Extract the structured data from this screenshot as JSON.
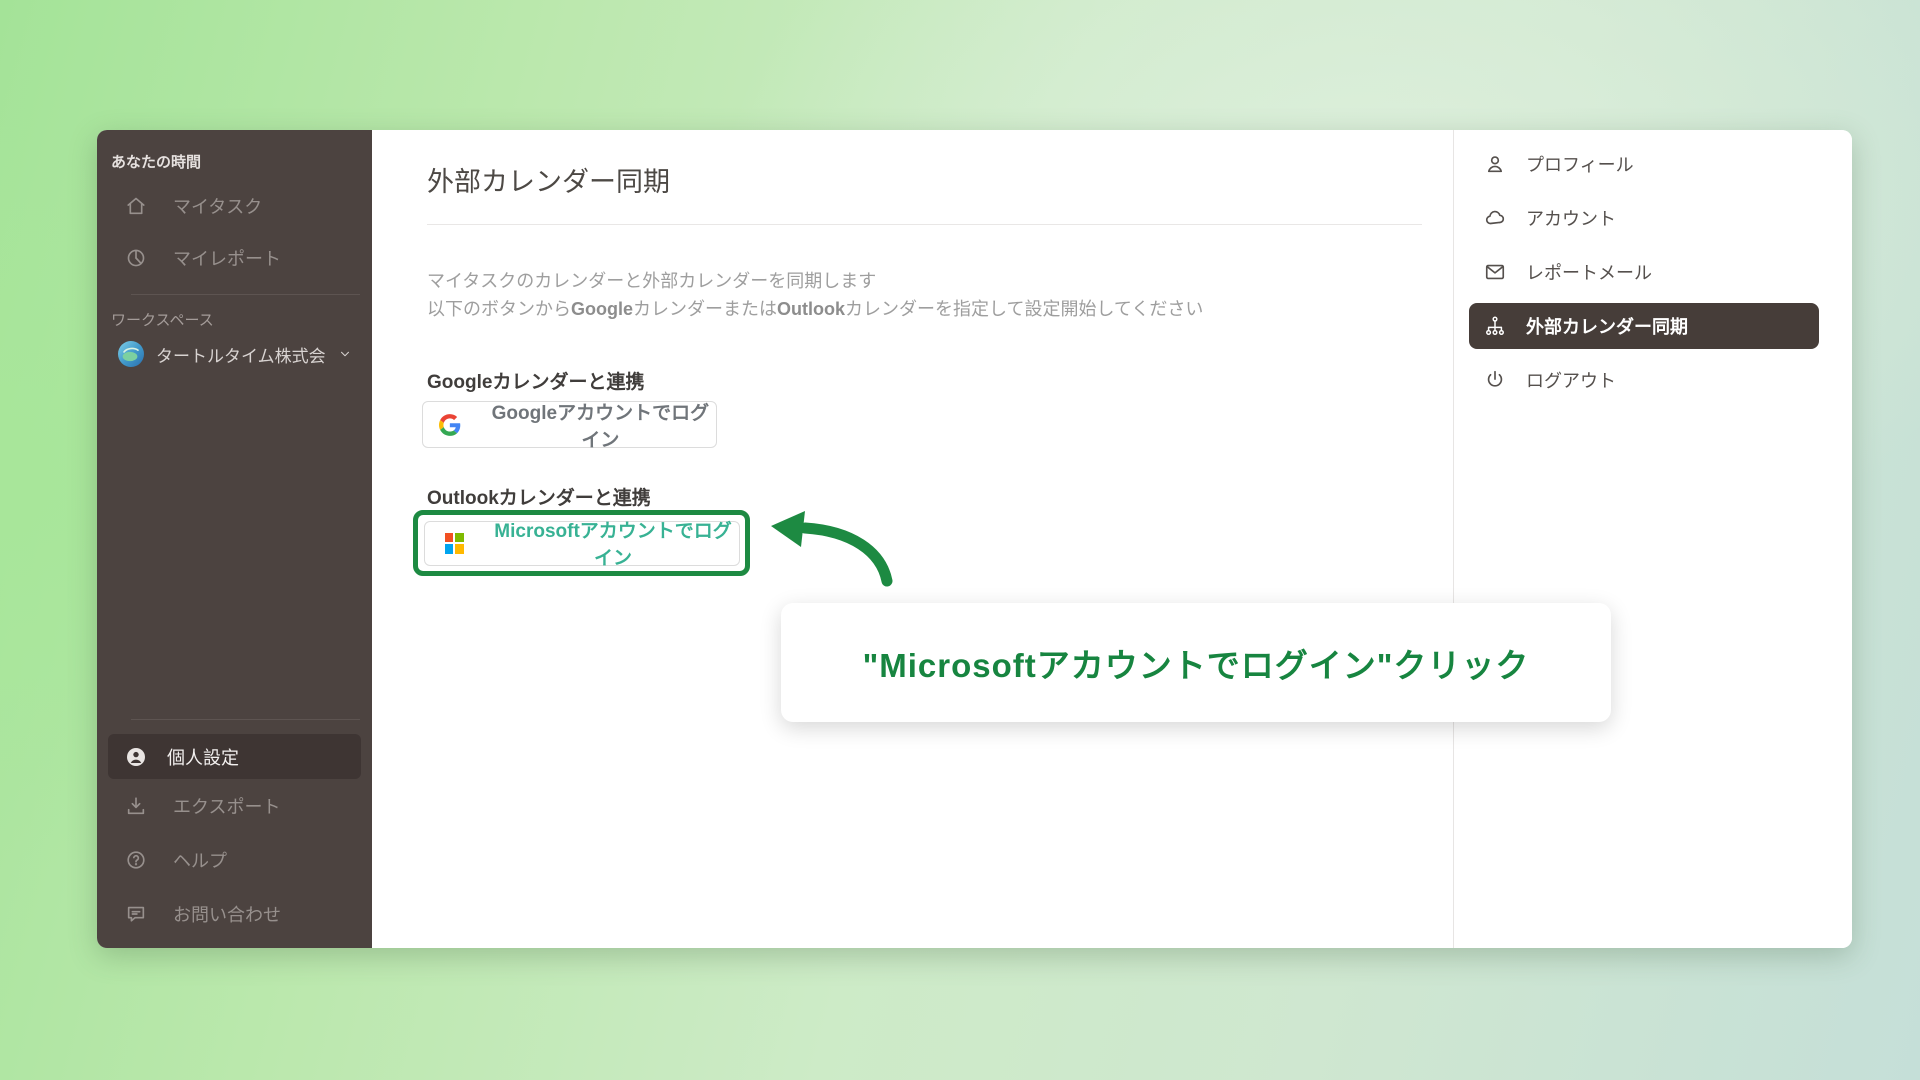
{
  "left_sidebar": {
    "header": "あなたの時間",
    "top_items": [
      {
        "label": "マイタスク"
      },
      {
        "label": "マイレポート"
      }
    ],
    "workspace_label": "ワークスペース",
    "workspace": {
      "name": "タートルタイム株式会..."
    },
    "bottom_items": [
      {
        "label": "個人設定",
        "active": true
      },
      {
        "label": "エクスポート"
      },
      {
        "label": "ヘルプ"
      },
      {
        "label": "お問い合わせ"
      }
    ]
  },
  "main": {
    "title": "外部カレンダー同期",
    "description_line1": "マイタスクのカレンダーと外部カレンダーを同期します",
    "description_line2": {
      "pre": "以下のボタンから",
      "google": "Google",
      "mid": "カレンダーまたは",
      "outlook": "Outlook",
      "post": "カレンダーを指定して設定開始してください"
    },
    "google_section": {
      "label": "Googleカレンダーと連携",
      "button_label": "Googleアカウントでログイン"
    },
    "outlook_section": {
      "label": "Outlookカレンダーと連携",
      "button_label": "Microsoftアカウントでログイン"
    },
    "annotation": {
      "tooltip_text": "\"Microsoftアカウントでログイン\"クリック"
    }
  },
  "right_sidebar": {
    "items": [
      {
        "label": "プロフィール"
      },
      {
        "label": "アカウント"
      },
      {
        "label": "レポートメール"
      },
      {
        "label": "外部カレンダー同期",
        "active": true
      },
      {
        "label": "ログアウト"
      }
    ]
  },
  "colors": {
    "annotation_green": "#1d8a42",
    "tooltip_text_green": "#178540",
    "microsoft_button_text": "#38b294",
    "sidebar_bg": "#4c4340",
    "active_item_bg": "#3e3533",
    "right_active_bg": "#463d39",
    "ms_logo": {
      "tl": "#f25022",
      "tr": "#7fba00",
      "bl": "#00a4ef",
      "br": "#ffb900"
    },
    "google_logo": {
      "red": "#EA4335",
      "blue": "#4285F4",
      "yellow": "#FBBC05",
      "green": "#34A853"
    }
  }
}
